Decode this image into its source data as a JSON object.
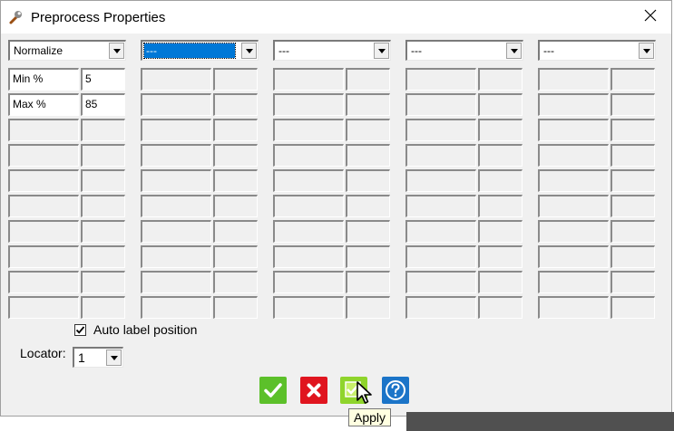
{
  "window": {
    "title": "Preprocess Properties",
    "close_glyph": "✕",
    "icon": "wrench-icon"
  },
  "columns": [
    {
      "selected": "Normalize",
      "focused": false,
      "rows": [
        {
          "label": "Min %",
          "value": "5"
        },
        {
          "label": "Max %",
          "value": "85"
        },
        {
          "label": "",
          "value": ""
        },
        {
          "label": "",
          "value": ""
        },
        {
          "label": "",
          "value": ""
        },
        {
          "label": "",
          "value": ""
        },
        {
          "label": "",
          "value": ""
        },
        {
          "label": "",
          "value": ""
        },
        {
          "label": "",
          "value": ""
        },
        {
          "label": "",
          "value": ""
        }
      ]
    },
    {
      "selected": "---",
      "focused": true,
      "rows": []
    },
    {
      "selected": "---",
      "focused": false,
      "rows": []
    },
    {
      "selected": "---",
      "focused": false,
      "rows": []
    },
    {
      "selected": "---",
      "focused": false,
      "rows": []
    }
  ],
  "auto_label": {
    "label": "Auto label position",
    "checked": true
  },
  "locator": {
    "label": "Locator:",
    "value": "1"
  },
  "buttons": {
    "ok": {
      "icon": "checkmark-icon",
      "color": "#5cc02a"
    },
    "cancel": {
      "icon": "x-icon",
      "color": "#e0151f"
    },
    "apply": {
      "icon": "apply-check-icon",
      "color": "#8fd42c"
    },
    "help": {
      "icon": "question-icon",
      "color": "#1b74c8"
    }
  },
  "tooltip": "Apply"
}
